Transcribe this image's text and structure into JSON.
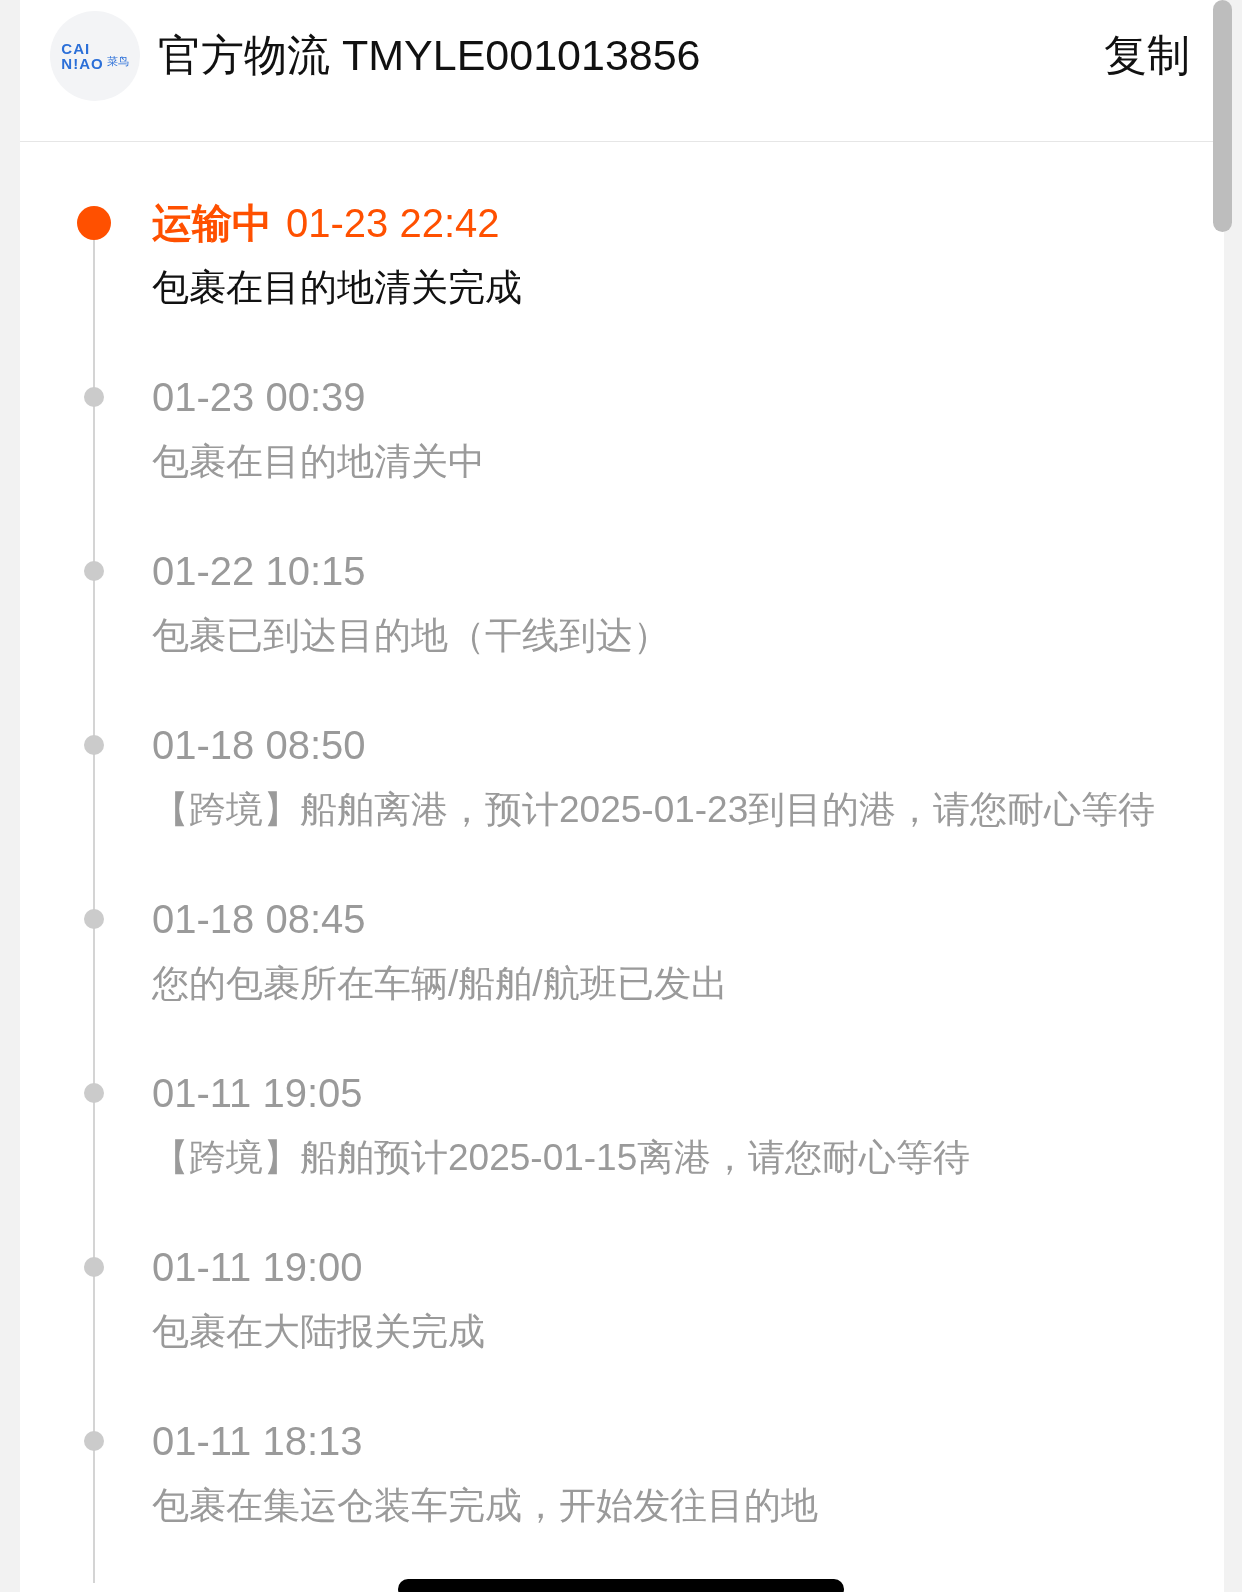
{
  "header": {
    "logo": {
      "line_1": "CAI",
      "line_2": "N!AO",
      "chinese": "菜鸟"
    },
    "title": "官方物流 TMYLE001013856",
    "copy_button": "复制"
  },
  "timeline": [
    {
      "active": true,
      "status": "运输中",
      "time": "01-23 22:42",
      "description": "包裹在目的地清关完成"
    },
    {
      "active": false,
      "time": "01-23 00:39",
      "description": "包裹在目的地清关中"
    },
    {
      "active": false,
      "time": "01-22 10:15",
      "description": "包裹已到达目的地（干线到达）"
    },
    {
      "active": false,
      "time": "01-18 08:50",
      "description": "【跨境】船舶离港，预计2025-01-23到目的港，请您耐心等待"
    },
    {
      "active": false,
      "time": "01-18 08:45",
      "description": "您的包裹所在车辆/船舶/航班已发出"
    },
    {
      "active": false,
      "time": "01-11 19:05",
      "description": "【跨境】船舶预计2025-01-15离港，请您耐心等待"
    },
    {
      "active": false,
      "time": "01-11 19:00",
      "description": "包裹在大陆报关完成"
    },
    {
      "active": false,
      "time": "01-11 18:13",
      "description": "包裹在集运仓装车完成，开始发往目的地"
    }
  ]
}
